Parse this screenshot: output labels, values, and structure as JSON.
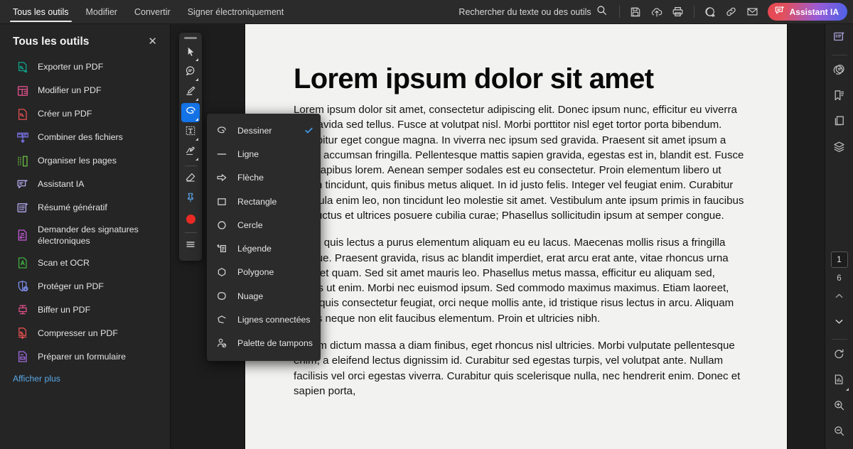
{
  "app": {
    "name": "Adobe Acrobat",
    "accent": "#1473e6",
    "panel_bg": "#252525"
  },
  "topbar": {
    "tabs": [
      {
        "label": "Tous les outils",
        "active": true
      },
      {
        "label": "Modifier",
        "active": false
      },
      {
        "label": "Convertir",
        "active": false
      },
      {
        "label": "Signer électroniquement",
        "active": false
      }
    ],
    "search_label": "Rechercher du texte ou des outils",
    "search_icon": "search-icon",
    "actions": [
      {
        "name": "save-icon",
        "title": "Enregistrer"
      },
      {
        "name": "cloud-upload-icon",
        "title": "Envoyer vers le cloud"
      },
      {
        "name": "print-icon",
        "title": "Imprimer"
      },
      {
        "name": "add-comment-icon",
        "title": "Ajouter un commentaire"
      },
      {
        "name": "link-icon",
        "title": "Partager un lien"
      },
      {
        "name": "mail-icon",
        "title": "Envoyer par e-mail"
      }
    ],
    "ai_button": {
      "label": "Assistant IA",
      "icon": "ai-sparkle-icon",
      "gradient_from": "#e8474f",
      "gradient_to": "#4b62e8"
    }
  },
  "sidebar": {
    "title": "Tous les outils",
    "close_icon": "close-icon",
    "show_more": "Afficher plus",
    "items": [
      {
        "label": "Exporter un PDF",
        "icon": "export-pdf-icon",
        "color": "#0fa38a"
      },
      {
        "label": "Modifier un PDF",
        "icon": "edit-pdf-icon",
        "color": "#e0508a"
      },
      {
        "label": "Créer un PDF",
        "icon": "create-pdf-icon",
        "color": "#e35050"
      },
      {
        "label": "Combiner des fichiers",
        "icon": "combine-files-icon",
        "color": "#7b74e8"
      },
      {
        "label": "Organiser les pages",
        "icon": "organize-pages-icon",
        "color": "#6cbf43"
      },
      {
        "label": "Assistant IA",
        "icon": "ai-assistant-icon",
        "color": "#b5a9ef"
      },
      {
        "label": "Résumé génératif",
        "icon": "generative-summary-icon",
        "color": "#b5a9ef"
      },
      {
        "label": "Demander des signatures électroniques",
        "icon": "request-signatures-icon",
        "color": "#c45ad6"
      },
      {
        "label": "Scan et OCR",
        "icon": "scan-ocr-icon",
        "color": "#3fae3f"
      },
      {
        "label": "Protéger un PDF",
        "icon": "protect-pdf-icon",
        "color": "#7b8be8"
      },
      {
        "label": "Biffer un PDF",
        "icon": "redact-pdf-icon",
        "color": "#e0508a"
      },
      {
        "label": "Compresser un PDF",
        "icon": "compress-pdf-icon",
        "color": "#e35050"
      },
      {
        "label": "Préparer un formulaire",
        "icon": "prepare-form-icon",
        "color": "#a06adf"
      }
    ]
  },
  "vertical_toolbar": {
    "grip": "drag-handle",
    "tools": [
      {
        "name": "select-tool",
        "icon": "cursor-icon",
        "has_caret": true,
        "active": false
      },
      {
        "name": "comment-tool",
        "icon": "speech-bubble-icon",
        "has_caret": true,
        "active": false
      },
      {
        "name": "highlight-tool",
        "icon": "highlighter-icon",
        "has_caret": true,
        "active": false
      },
      {
        "name": "draw-tool",
        "icon": "draw-loop-icon",
        "has_caret": true,
        "active": true
      },
      {
        "name": "text-box-tool",
        "icon": "text-box-icon",
        "has_caret": true,
        "active": false
      },
      {
        "name": "signature-tool",
        "icon": "signature-icon",
        "has_caret": true,
        "active": false
      },
      {
        "name": "eraser-tool",
        "icon": "eraser-icon",
        "has_caret": false,
        "active": false
      },
      {
        "name": "pin-tool",
        "icon": "pin-icon",
        "has_caret": false,
        "active": false
      },
      {
        "name": "color-swatch",
        "icon": "red-circle-icon",
        "has_caret": false,
        "active": false
      },
      {
        "name": "more-options",
        "icon": "hamburger-icon",
        "has_caret": false,
        "active": false
      }
    ]
  },
  "draw_menu": {
    "items": [
      {
        "label": "Dessiner",
        "icon": "draw-loop-icon",
        "checked": true
      },
      {
        "label": "Ligne",
        "icon": "line-icon",
        "checked": false
      },
      {
        "label": "Flèche",
        "icon": "arrow-icon",
        "checked": false
      },
      {
        "label": "Rectangle",
        "icon": "rectangle-icon",
        "checked": false
      },
      {
        "label": "Cercle",
        "icon": "circle-icon",
        "checked": false
      },
      {
        "label": "Légende",
        "icon": "callout-icon",
        "checked": false
      },
      {
        "label": "Polygone",
        "icon": "polygon-icon",
        "checked": false
      },
      {
        "label": "Nuage",
        "icon": "cloud-shape-icon",
        "checked": false
      },
      {
        "label": "Lignes connectées",
        "icon": "connected-lines-icon",
        "checked": false
      },
      {
        "label": "Palette de tampons",
        "icon": "stamp-palette-icon",
        "checked": false
      }
    ],
    "check_color": "#3c9ae8"
  },
  "document": {
    "title": "Lorem ipsum dolor sit amet",
    "paragraphs": [
      "Lorem ipsum dolor sit amet, consectetur adipiscing elit. Donec ipsum nunc, efficitur eu viverra in, gravida sed tellus. Fusce at volutpat nisl. Morbi porttitor nisl eget tortor porta bibendum. Curabitur eget congue magna. In viverra nec ipsum sed gravida. Praesent sit amet ipsum a quam accumsan fringilla. Pellentesque mattis sapien gravida, egestas est in, blandit est. Fusce non dapibus lorem. Aenean semper sodales est eu consectetur. Proin elementum libero ut ipsum tincidunt, quis finibus metus aliquet. In id justo felis. Integer vel feugiat enim. Curabitur vehicula enim leo, non tincidunt leo molestie sit amet. Vestibulum ante ipsum primis in faucibus orci luctus et ultrices posuere cubilia curae; Phasellus sollicitudin ipsum at semper congue.",
      "Etiam quis lectus a purus elementum aliquam eu eu lacus. Maecenas mollis risus a fringilla congue. Praesent gravida, risus ac blandit imperdiet, erat arcu erat ante, vitae rhoncus urna enim et quam. Sed sit amet mauris leo. Phasellus metus massa, efficitur eu aliquam sed, iaculis ut enim. Morbi nec euismod ipsum. Sed commodo maximus maximus. Etiam laoreet, nulla quis consectetur feugiat, orci neque mollis ante, id tristique risus lectus in arcu. Aliquam mattis neque non elit faucibus elementum. Proin et ultricies nibh.",
      "Nullam dictum massa a diam finibus, eget rhoncus nisl ultricies. Morbi vulputate pellentesque enim, a eleifend lectus dignissim id. Curabitur sed egestas turpis, vel volutpat ante. Nullam facilisis vel orci egestas viverra. Curabitur quis scelerisque nulla, nec hendrerit enim. Donec et sapien porta,"
    ]
  },
  "right_rail": {
    "top_buttons": [
      {
        "name": "ai-assistant-rail-icon",
        "title": "Assistant IA"
      },
      {
        "name": "comments-rail-icon",
        "title": "Commentaires"
      },
      {
        "name": "bookmarks-rail-icon",
        "title": "Signets"
      },
      {
        "name": "page-thumbnails-rail-icon",
        "title": "Vignettes de page"
      },
      {
        "name": "layers-rail-icon",
        "title": "Calques"
      }
    ],
    "page_current": "1",
    "page_total": "6",
    "nav": [
      {
        "name": "page-up-button",
        "icon": "chevron-up-icon"
      },
      {
        "name": "page-down-button",
        "icon": "chevron-down-icon"
      }
    ],
    "bottom_buttons": [
      {
        "name": "rotate-button",
        "icon": "rotate-icon"
      },
      {
        "name": "page-tools-button",
        "icon": "page-stats-icon"
      },
      {
        "name": "zoom-in-button",
        "icon": "zoom-in-icon"
      },
      {
        "name": "zoom-out-button",
        "icon": "zoom-out-icon"
      }
    ]
  }
}
